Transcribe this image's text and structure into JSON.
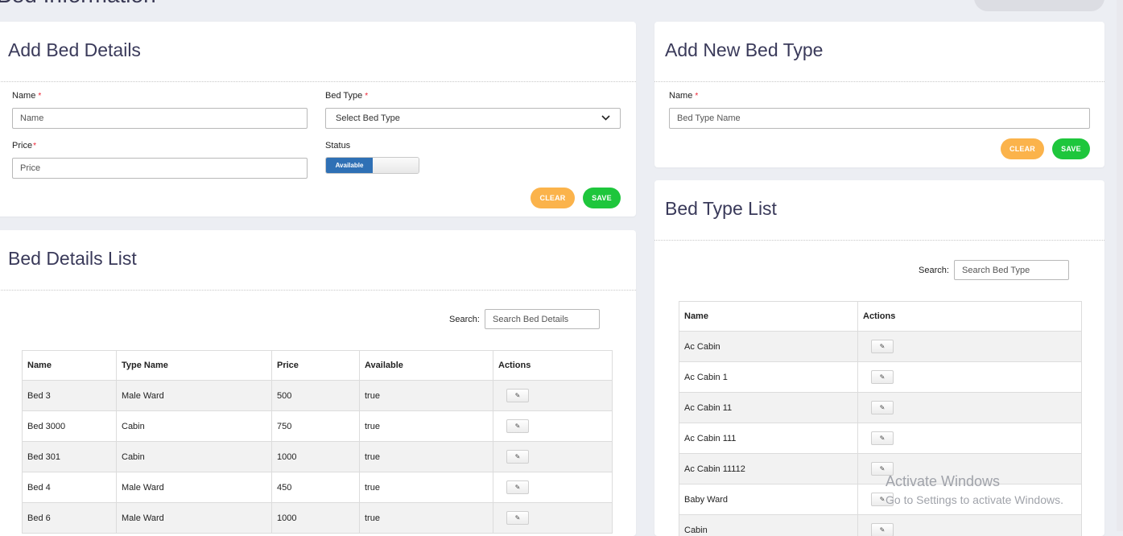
{
  "page": {
    "title": "Bed Information"
  },
  "add_bed": {
    "title": "Add Bed Details",
    "name_label": "Name",
    "name_placeholder": "Name",
    "bed_type_label": "Bed Type",
    "bed_type_selected": "Select Bed Type",
    "price_label": "Price",
    "price_placeholder": "Price",
    "status_label": "Status",
    "status_toggle": "Available",
    "required_mark": "*",
    "clear_label": "CLEAR",
    "save_label": "SAVE"
  },
  "add_bed_type": {
    "title": "Add New Bed Type",
    "name_label": "Name",
    "name_placeholder": "Bed Type Name",
    "required_mark": "*",
    "clear_label": "CLEAR",
    "save_label": "SAVE"
  },
  "bed_list": {
    "title": "Bed Details List",
    "search_label": "Search:",
    "search_placeholder": "Search Bed Details",
    "columns": [
      "Name",
      "Type Name",
      "Price",
      "Available",
      "Actions"
    ],
    "rows": [
      [
        "Bed 3",
        "Male Ward",
        "500",
        "true"
      ],
      [
        "Bed 3000",
        "Cabin",
        "750",
        "true"
      ],
      [
        "Bed 301",
        "Cabin",
        "1000",
        "true"
      ],
      [
        "Bed 4",
        "Male Ward",
        "450",
        "true"
      ],
      [
        "Bed 6",
        "Male Ward",
        "1000",
        "true"
      ]
    ],
    "edit_icon": "edit-icon"
  },
  "bed_type_list": {
    "title": "Bed Type List",
    "search_label": "Search:",
    "search_placeholder": "Search Bed Type",
    "columns": [
      "Name",
      "Actions"
    ],
    "rows": [
      "Ac Cabin",
      "Ac Cabin 1",
      "Ac Cabin 11",
      "Ac Cabin 111",
      "Ac Cabin 11112",
      "Baby Ward",
      "Cabin"
    ],
    "edit_icon": "edit-icon"
  },
  "watermark": {
    "line1": "Activate Windows",
    "line2": "Go to Settings to activate Windows."
  },
  "colors": {
    "clear": "#fbb34b",
    "save": "#1ec63c",
    "toggle": "#2f70b5",
    "background": "#eceef3"
  }
}
